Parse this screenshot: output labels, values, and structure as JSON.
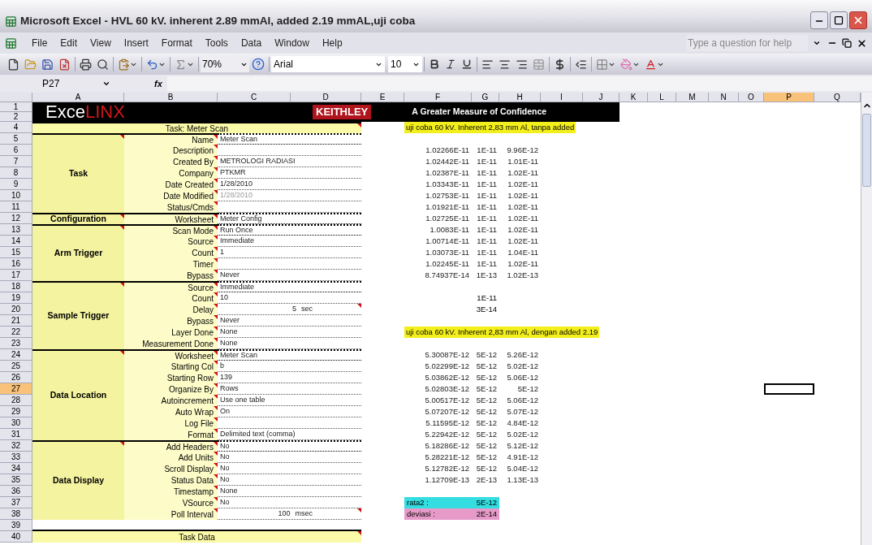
{
  "window": {
    "title": "Microsoft Excel - HVL 60 kV. inherent 2.89 mmAl, added 2.19 mmAL,uji coba"
  },
  "menu": [
    "File",
    "Edit",
    "View",
    "Insert",
    "Format",
    "Tools",
    "Data",
    "Window",
    "Help"
  ],
  "help_field": {
    "placeholder": "Type a question for help"
  },
  "toolbar": {
    "zoom": "70%",
    "font": "Arial",
    "font_size": "10"
  },
  "formula_bar": {
    "name_box": "P27",
    "function_label": "fx"
  },
  "columns": [
    {
      "label": "A",
      "selected": false
    },
    {
      "label": "B",
      "selected": false
    },
    {
      "label": "C",
      "selected": false
    },
    {
      "label": "D",
      "selected": false
    },
    {
      "label": "E",
      "selected": false
    },
    {
      "label": "F",
      "selected": false
    },
    {
      "label": "G",
      "selected": false
    },
    {
      "label": "H",
      "selected": false
    },
    {
      "label": "I",
      "selected": false
    },
    {
      "label": "J",
      "selected": false
    },
    {
      "label": "K",
      "selected": false
    },
    {
      "label": "L",
      "selected": false
    },
    {
      "label": "M",
      "selected": false
    },
    {
      "label": "N",
      "selected": false
    },
    {
      "label": "O",
      "selected": false
    },
    {
      "label": "P",
      "selected": true
    },
    {
      "label": "Q",
      "selected": false
    }
  ],
  "rows": [
    {
      "label": "1",
      "selected": false
    },
    {
      "label": "2",
      "selected": false
    },
    {
      "label": "4",
      "selected": false
    },
    {
      "label": "5",
      "selected": false
    },
    {
      "label": "6",
      "selected": false
    },
    {
      "label": "7",
      "selected": false
    },
    {
      "label": "8",
      "selected": false
    },
    {
      "label": "9",
      "selected": false
    },
    {
      "label": "10",
      "selected": false
    },
    {
      "label": "11",
      "selected": false
    },
    {
      "label": "12",
      "selected": false
    },
    {
      "label": "13",
      "selected": false
    },
    {
      "label": "14",
      "selected": false
    },
    {
      "label": "15",
      "selected": false
    },
    {
      "label": "16",
      "selected": false
    },
    {
      "label": "17",
      "selected": false
    },
    {
      "label": "18",
      "selected": false
    },
    {
      "label": "19",
      "selected": false
    },
    {
      "label": "20",
      "selected": false
    },
    {
      "label": "21",
      "selected": false
    },
    {
      "label": "22",
      "selected": false
    },
    {
      "label": "23",
      "selected": false
    },
    {
      "label": "24",
      "selected": false
    },
    {
      "label": "25",
      "selected": false
    },
    {
      "label": "26",
      "selected": false
    },
    {
      "label": "27",
      "selected": true
    },
    {
      "label": "28",
      "selected": false
    },
    {
      "label": "29",
      "selected": false
    },
    {
      "label": "30",
      "selected": false
    },
    {
      "label": "31",
      "selected": false
    },
    {
      "label": "32",
      "selected": false
    },
    {
      "label": "33",
      "selected": false
    },
    {
      "label": "34",
      "selected": false
    },
    {
      "label": "35",
      "selected": false
    },
    {
      "label": "36",
      "selected": false
    },
    {
      "label": "37",
      "selected": false
    },
    {
      "label": "38",
      "selected": false
    },
    {
      "label": "39",
      "selected": false
    },
    {
      "label": "40",
      "selected": false
    }
  ],
  "banner": {
    "logo_main": "Exce",
    "logo_accent": "LINX",
    "brand": "KEITHLEY",
    "tagline": "A Greater Measure of Confidence"
  },
  "task_title": "Task: Meter Scan",
  "sections": [
    {
      "label": "Task",
      "fields": [
        {
          "kind": "text",
          "label": "Name",
          "value": "Meter Scan",
          "disabled": false
        },
        {
          "kind": "text",
          "label": "Description"
        },
        {
          "kind": "text",
          "label": "Created By",
          "value": "METROLOGI RADIASI",
          "disabled": false
        },
        {
          "kind": "text",
          "label": "Company",
          "value": "PTKMR",
          "disabled": false
        },
        {
          "kind": "text",
          "label": "Date Created",
          "value": "1/28/2010",
          "disabled": false
        },
        {
          "kind": "text",
          "label": "Date Modified",
          "value": "1/28/2010",
          "disabled": true
        },
        {
          "kind": "text",
          "label": "Status/Cmds"
        }
      ]
    },
    {
      "label": "Configuration",
      "fields": [
        {
          "kind": "text",
          "label": "Worksheet",
          "value": "Meter Config",
          "disabled": false
        }
      ]
    },
    {
      "label": "Arm Trigger",
      "fields": [
        {
          "kind": "text",
          "label": "Scan Mode",
          "value": "Run Once",
          "disabled": false
        },
        {
          "kind": "text",
          "label": "Source",
          "value": "Immediate",
          "disabled": false
        },
        {
          "kind": "text",
          "label": "Count",
          "value": "1",
          "disabled": false
        },
        {
          "kind": "text",
          "label": "Timer"
        },
        {
          "kind": "text",
          "label": "Bypass",
          "value": "Never",
          "disabled": false
        }
      ]
    },
    {
      "label": "Sample Trigger",
      "fields": [
        {
          "kind": "text",
          "label": "Source",
          "value": "Immediate",
          "disabled": false
        },
        {
          "kind": "text",
          "label": "Count",
          "value": "10",
          "disabled": false
        },
        {
          "kind": "number",
          "label": "Delay",
          "value": "5",
          "unit": "sec",
          "disabled": false
        },
        {
          "kind": "text",
          "label": "Bypass",
          "value": "Never",
          "disabled": false
        },
        {
          "kind": "text",
          "label": "Layer Done",
          "value": "None",
          "disabled": false
        },
        {
          "kind": "text",
          "label": "Measurement Done",
          "value": "None",
          "disabled": false
        }
      ]
    },
    {
      "label": "Data Location",
      "fields": [
        {
          "kind": "text",
          "label": "Worksheet",
          "value": "Meter Scan",
          "disabled": false
        },
        {
          "kind": "text",
          "label": "Starting Col",
          "value": "b",
          "disabled": false
        },
        {
          "kind": "text",
          "label": "Starting Row",
          "value": "139",
          "disabled": false
        },
        {
          "kind": "text",
          "label": "Organize By",
          "value": "Rows",
          "disabled": false
        },
        {
          "kind": "text",
          "label": "Autoincrement",
          "value": "Use one table",
          "disabled": false
        },
        {
          "kind": "text",
          "label": "Auto Wrap",
          "value": "On",
          "disabled": false
        },
        {
          "kind": "text",
          "label": "Log File"
        },
        {
          "kind": "text",
          "label": "Format",
          "value": "Delimited text (comma)",
          "disabled": false
        }
      ]
    },
    {
      "label": "Data Display",
      "fields": [
        {
          "kind": "text",
          "label": "Add Headers",
          "value": "No",
          "disabled": false
        },
        {
          "kind": "text",
          "label": "Add Units",
          "value": "No",
          "disabled": false
        },
        {
          "kind": "text",
          "label": "Scroll Display",
          "value": "No",
          "disabled": false
        },
        {
          "kind": "text",
          "label": "Status Data",
          "value": "No",
          "disabled": false
        },
        {
          "kind": "text",
          "label": "Timestamp",
          "value": "None",
          "disabled": false
        },
        {
          "kind": "text",
          "label": "VSource",
          "value": "No",
          "disabled": false
        },
        {
          "kind": "number",
          "label": "Poll Interval",
          "value": "100",
          "unit": "msec",
          "disabled": false
        }
      ]
    }
  ],
  "footer_title": "Task Data",
  "measurements": [
    {
      "note": "uji coba 60 kV. Inherent 2,83 mm Al, tanpa added",
      "rows": [
        [
          "1.02266E-11",
          "1E-11",
          "9.96E-12"
        ],
        [
          "1.02442E-11",
          "1E-11",
          "1.01E-11"
        ],
        [
          "1.02387E-11",
          "1E-11",
          "1.02E-11"
        ],
        [
          "1.03343E-11",
          "1E-11",
          "1.02E-11"
        ],
        [
          "1.02753E-11",
          "1E-11",
          "1.02E-11"
        ],
        [
          "1.01921E-11",
          "1E-11",
          "1.02E-11"
        ],
        [
          "1.02725E-11",
          "1E-11",
          "1.02E-11"
        ],
        [
          "1.0083E-11",
          "1E-11",
          "1.02E-11"
        ],
        [
          "1.00714E-11",
          "1E-11",
          "1.02E-11"
        ],
        [
          "1.03073E-11",
          "1E-11",
          "1.04E-11"
        ],
        [
          "1.02245E-11",
          "1E-11",
          "1.02E-11"
        ],
        [
          "8.74937E-14",
          "1E-13",
          "1.02E-13"
        ]
      ],
      "extra": [
        "1E-11",
        "3E-14"
      ]
    },
    {
      "note": "uji coba 60 kV. Inherent 2,83 mm Al, dengan added 2.19",
      "rows": [
        [
          "5.30087E-12",
          "5E-12",
          "5.26E-12"
        ],
        [
          "5.02299E-12",
          "5E-12",
          "5.02E-12"
        ],
        [
          "5.03862E-12",
          "5E-12",
          "5.06E-12"
        ],
        [
          "5.02803E-12",
          "5E-12",
          "5E-12"
        ],
        [
          "5.00517E-12",
          "5E-12",
          "5.06E-12"
        ],
        [
          "5.07207E-12",
          "5E-12",
          "5.07E-12"
        ],
        [
          "5.11595E-12",
          "5E-12",
          "4.84E-12"
        ],
        [
          "5.22942E-12",
          "5E-12",
          "5.02E-12"
        ],
        [
          "5.18286E-12",
          "5E-12",
          "5.12E-12"
        ],
        [
          "5.28221E-12",
          "5E-12",
          "4.91E-12"
        ],
        [
          "5.12782E-12",
          "5E-12",
          "5.04E-12"
        ],
        [
          "1.12709E-13",
          "2E-13",
          "1.13E-13"
        ]
      ],
      "summary": [
        {
          "label": "rata2 :",
          "value": "5E-12",
          "color": "#33dde0"
        },
        {
          "label": "deviasi :",
          "value": "2E-14",
          "color": "#e79ac8"
        }
      ]
    }
  ]
}
